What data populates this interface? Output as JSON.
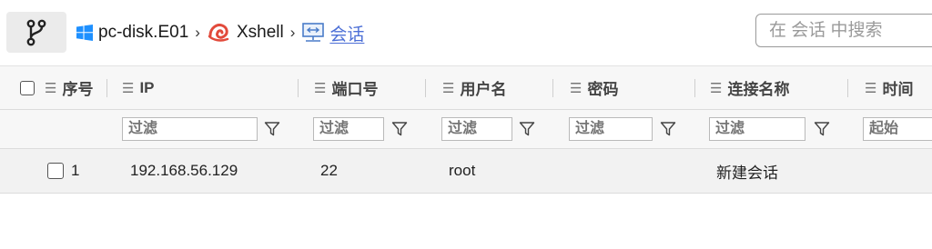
{
  "breadcrumb": [
    {
      "label": "pc-disk.E01",
      "icon": "windows-icon"
    },
    {
      "label": "Xshell",
      "icon": "xshell-icon"
    },
    {
      "label": "会话",
      "icon": "session-icon"
    }
  ],
  "search": {
    "placeholder": "在 会话 中搜索"
  },
  "table": {
    "columns": [
      "序号",
      "IP",
      "端口号",
      "用户名",
      "密码",
      "连接名称",
      "时间"
    ],
    "filter_placeholder": "过滤",
    "time_filter_placeholder": "起始",
    "rows": [
      {
        "index": "1",
        "ip": "192.168.56.129",
        "port": "22",
        "user": "root",
        "password": "",
        "name": "新建会话",
        "time": ""
      }
    ]
  },
  "colors": {
    "accent": "#4c6fd6",
    "windows_blue": "#1e90ff",
    "xshell_red": "#e24a3b"
  }
}
